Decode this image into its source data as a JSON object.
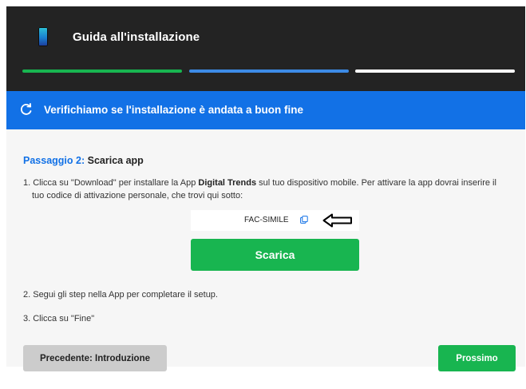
{
  "header": {
    "title": "Guida all'installazione",
    "icon": "phone-icon"
  },
  "progress": {
    "steps": [
      {
        "state": "complete",
        "color": "#18b550"
      },
      {
        "state": "current",
        "color": "#3d8be6"
      },
      {
        "state": "pending",
        "color": "#ffffff"
      }
    ]
  },
  "banner": {
    "text": "Verifichiamo se l'installazione è andata a buon fine",
    "icon": "refresh-icon",
    "color": "#1271e6"
  },
  "step": {
    "prefix": "Passaggio 2:",
    "name": "Scarica app"
  },
  "instructions": {
    "item1_a": "1. Clicca su \"Download\" per installare la App ",
    "item1_bold": "Digital Trends",
    "item1_b": " sul tuo dispositivo mobile. Per attivare la app dovrai inserire il",
    "item1_c": "tuo codice di attivazione personale, che trovi qui sotto:",
    "item2": "2. Segui gli step nella App per completare il setup.",
    "item3": "3. Clicca su \"Fine\""
  },
  "activation": {
    "code": "FAC-SIMILE",
    "copy_icon": "copy-icon",
    "pointer_icon": "arrow-left-icon"
  },
  "buttons": {
    "download": "Scarica",
    "previous": "Precedente: Introduzione",
    "next": "Prossimo"
  },
  "colors": {
    "accent_green": "#18b550",
    "accent_blue": "#1271e6",
    "header_bg": "#232323",
    "secondary_button": "#cccccc"
  }
}
